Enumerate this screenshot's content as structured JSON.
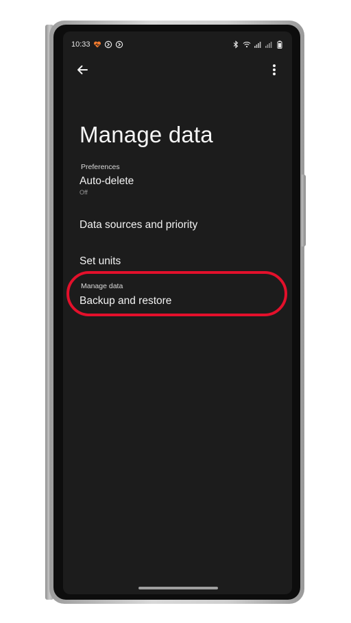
{
  "status_bar": {
    "time": "10:33"
  },
  "app_bar": {
    "back_icon": "arrow-left-icon",
    "more_icon": "more-vert-icon"
  },
  "page": {
    "title": "Manage data"
  },
  "sections": {
    "preferences": {
      "header": "Preferences",
      "items": [
        {
          "label": "Auto-delete",
          "value": "Off"
        },
        {
          "label": "Data sources and priority"
        },
        {
          "label": "Set units"
        }
      ]
    },
    "manage_data": {
      "header": "Manage data",
      "items": [
        {
          "label": "Backup and restore"
        }
      ]
    }
  },
  "colors": {
    "screen_bg": "#1c1c1c",
    "highlight": "#e3102b",
    "notification_accent": "#f07a2e"
  }
}
